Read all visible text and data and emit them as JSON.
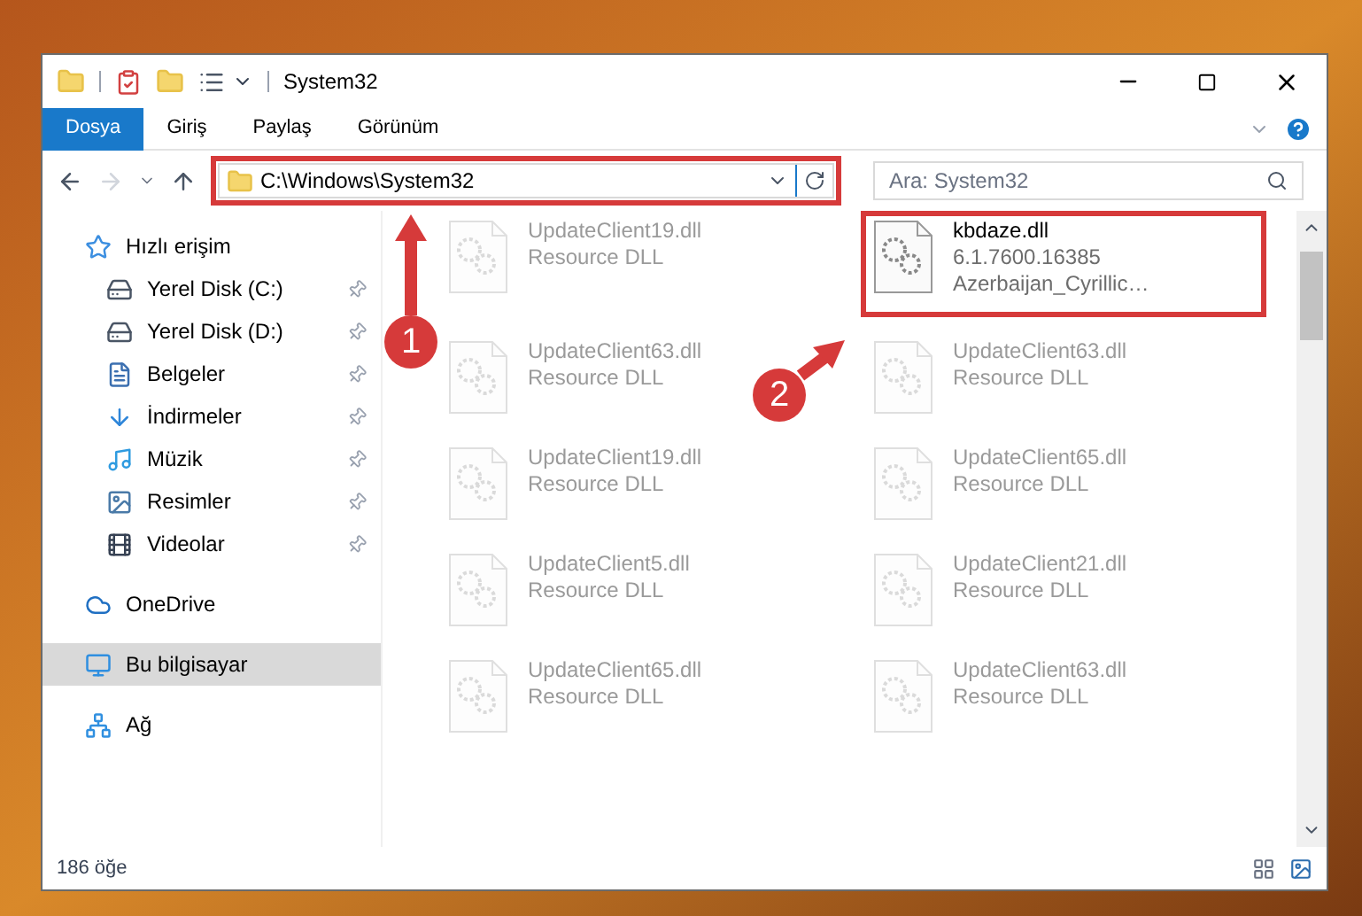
{
  "window": {
    "title": "System32"
  },
  "ribbon_tabs": [
    {
      "label": "Dosya",
      "selected": true
    },
    {
      "label": "Giriş",
      "selected": false
    },
    {
      "label": "Paylaş",
      "selected": false
    },
    {
      "label": "Görünüm",
      "selected": false
    }
  ],
  "address": {
    "path": "C:\\Windows\\System32",
    "highlighted": true
  },
  "search": {
    "placeholder": "Ara: System32"
  },
  "nav": [
    {
      "label": "Hızlı erişim",
      "kind": "star",
      "selected": false,
      "children": [
        {
          "label": "Yerel Disk (C:)",
          "kind": "disk",
          "pinned": true
        },
        {
          "label": "Yerel Disk (D:)",
          "kind": "disk",
          "pinned": true
        },
        {
          "label": "Belgeler",
          "kind": "document",
          "pinned": true
        },
        {
          "label": "İndirmeler",
          "kind": "download",
          "pinned": true
        },
        {
          "label": "Müzik",
          "kind": "music",
          "pinned": true
        },
        {
          "label": "Resimler",
          "kind": "picture",
          "pinned": true
        },
        {
          "label": "Videolar",
          "kind": "video",
          "pinned": true
        }
      ]
    },
    {
      "label": "OneDrive",
      "kind": "cloud",
      "selected": false
    },
    {
      "label": "Bu bilgisayar",
      "kind": "computer",
      "selected": true
    },
    {
      "label": "Ağ",
      "kind": "network",
      "selected": false
    }
  ],
  "files": [
    {
      "name": "UpdateClient19.dll",
      "lines": [
        "Resource DLL"
      ],
      "faded": true
    },
    {
      "name": "kbdaze.dll",
      "lines": [
        "6.1.7600.16385",
        "Azerbaijan_Cyrillic…"
      ],
      "faded": false,
      "highlighted": true
    },
    {
      "name": "UpdateClient63.dll",
      "lines": [
        "Resource DLL"
      ],
      "faded": true
    },
    {
      "name": "UpdateClient63.dll",
      "lines": [
        "Resource DLL"
      ],
      "faded": true
    },
    {
      "name": "UpdateClient19.dll",
      "lines": [
        "Resource DLL"
      ],
      "faded": true
    },
    {
      "name": "UpdateClient65.dll",
      "lines": [
        "Resource DLL"
      ],
      "faded": true
    },
    {
      "name": "UpdateClient5.dll",
      "lines": [
        "Resource DLL"
      ],
      "faded": true
    },
    {
      "name": "UpdateClient21.dll",
      "lines": [
        "Resource DLL"
      ],
      "faded": true
    },
    {
      "name": "UpdateClient65.dll",
      "lines": [
        "Resource DLL"
      ],
      "faded": true
    },
    {
      "name": "UpdateClient63.dll",
      "lines": [
        "Resource DLL"
      ],
      "faded": true
    }
  ],
  "status_bar": {
    "count": "186 öğe"
  },
  "annotations": [
    {
      "number": "1"
    },
    {
      "number": "2"
    }
  ]
}
